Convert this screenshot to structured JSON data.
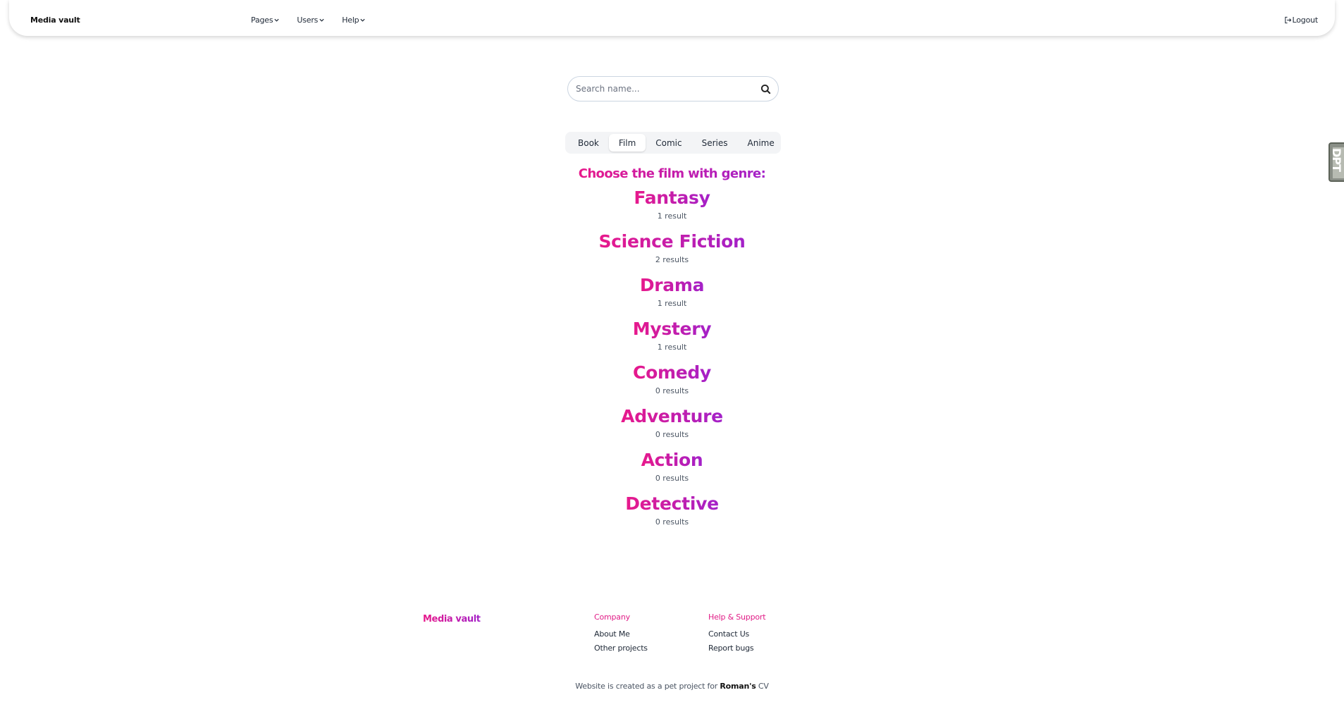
{
  "navbar": {
    "brand": "Media vault",
    "menu": [
      {
        "label": "Pages"
      },
      {
        "label": "Users"
      },
      {
        "label": "Help"
      }
    ],
    "logout_label": "Logout"
  },
  "search": {
    "placeholder": "Search name...",
    "value": ""
  },
  "tabs": [
    {
      "label": "Book",
      "active": false
    },
    {
      "label": "Film",
      "active": true
    },
    {
      "label": "Comic",
      "active": false
    },
    {
      "label": "Series",
      "active": false
    },
    {
      "label": "Anime",
      "active": false
    }
  ],
  "genre_section": {
    "heading": "Choose the film with genre:",
    "genres": [
      {
        "name": "Fantasy",
        "count": "1 result"
      },
      {
        "name": "Science Fiction",
        "count": "2 results"
      },
      {
        "name": "Drama",
        "count": "1 result"
      },
      {
        "name": "Mystery",
        "count": "1 result"
      },
      {
        "name": "Comedy",
        "count": "0 results"
      },
      {
        "name": "Adventure",
        "count": "0 results"
      },
      {
        "name": "Action",
        "count": "0 results"
      },
      {
        "name": "Detective",
        "count": "0 results"
      }
    ]
  },
  "side_widget": {
    "label": "DPT"
  },
  "footer": {
    "brand": "Media vault",
    "company": {
      "title": "Company",
      "links": [
        "About Me",
        "Other projects"
      ]
    },
    "help": {
      "title": "Help & Support",
      "links": [
        "Contact Us",
        "Report bugs"
      ]
    },
    "credit_prefix": "Website is created as a pet project for",
    "credit_name": "Roman's",
    "credit_suffix": "CV"
  },
  "colors": {
    "accent_start": "#e8198b",
    "accent_end": "#a321c9"
  }
}
